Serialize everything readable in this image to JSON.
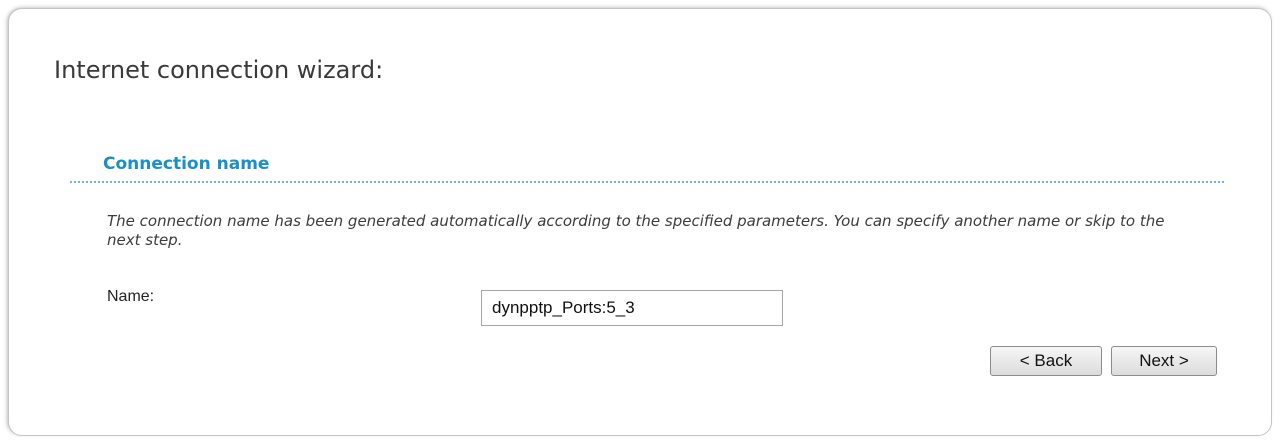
{
  "page": {
    "title": "Internet connection wizard:"
  },
  "section": {
    "title": "Connection name",
    "description": "The connection name has been generated automatically according to the specified parameters. You can specify another name or skip to the next step."
  },
  "form": {
    "name_label": "Name:",
    "name_value": "dynpptp_Ports:5_3"
  },
  "buttons": {
    "back_label": "< Back",
    "next_label": "Next >"
  },
  "colors": {
    "section_title": "#1a8fc9",
    "divider": "#6fb6dd"
  }
}
